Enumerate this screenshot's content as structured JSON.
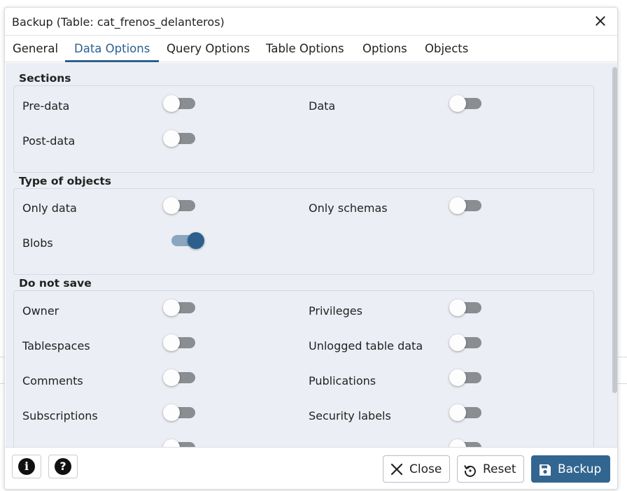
{
  "dialog": {
    "title": "Backup (Table: cat_frenos_delanteros)"
  },
  "tabs": [
    {
      "label": "General"
    },
    {
      "label": "Data Options"
    },
    {
      "label": "Query Options"
    },
    {
      "label": "Table Options"
    },
    {
      "label": "Options"
    },
    {
      "label": "Objects"
    }
  ],
  "active_tab": "Data Options",
  "sections": {
    "legend": "Sections",
    "pre_data": {
      "label": "Pre-data",
      "checked": false
    },
    "data": {
      "label": "Data",
      "checked": false
    },
    "post_data": {
      "label": "Post-data",
      "checked": false
    }
  },
  "type_of_objects": {
    "legend": "Type of objects",
    "only_data": {
      "label": "Only data",
      "checked": false
    },
    "only_schemas": {
      "label": "Only schemas",
      "checked": false
    },
    "blobs": {
      "label": "Blobs",
      "checked": true
    }
  },
  "do_not_save": {
    "legend": "Do not save",
    "owner": {
      "label": "Owner",
      "checked": false
    },
    "privileges": {
      "label": "Privileges",
      "checked": false
    },
    "tablespaces": {
      "label": "Tablespaces",
      "checked": false
    },
    "unlogged": {
      "label": "Unlogged table data",
      "checked": false
    },
    "comments": {
      "label": "Comments",
      "checked": false
    },
    "publications": {
      "label": "Publications",
      "checked": false
    },
    "subscriptions": {
      "label": "Subscriptions",
      "checked": false
    },
    "security_labels": {
      "label": "Security labels",
      "checked": false
    }
  },
  "footer": {
    "info_glyph": "i",
    "help_glyph": "?",
    "close_label": "Close",
    "reset_label": "Reset",
    "backup_label": "Backup"
  },
  "colors": {
    "accent": "#2c5f8e",
    "primary_button": "#326690",
    "panel_bg": "#ebeef4",
    "toggle_off": "#8a8d91"
  }
}
